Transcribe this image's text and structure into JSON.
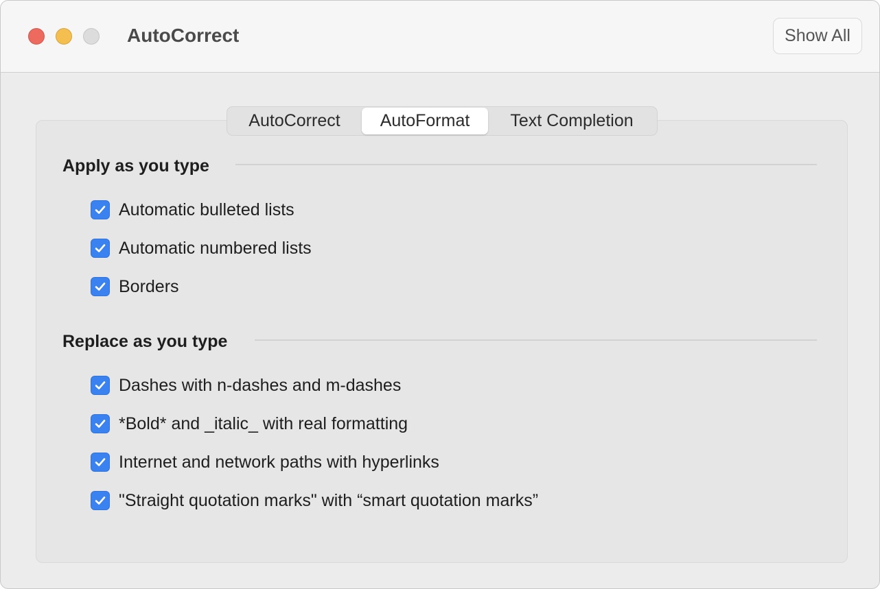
{
  "window": {
    "title": "AutoCorrect",
    "show_all_label": "Show All"
  },
  "tabs": [
    {
      "label": "AutoCorrect",
      "selected": false
    },
    {
      "label": "AutoFormat",
      "selected": true
    },
    {
      "label": "Text Completion",
      "selected": false
    }
  ],
  "sections": {
    "apply": {
      "title": "Apply as you type",
      "options": [
        {
          "label": "Automatic bulleted lists",
          "checked": true
        },
        {
          "label": "Automatic numbered lists",
          "checked": true
        },
        {
          "label": "Borders",
          "checked": true
        }
      ]
    },
    "replace": {
      "title": "Replace as you type",
      "options": [
        {
          "label": "Dashes with n-dashes and m-dashes",
          "checked": true
        },
        {
          "label": "*Bold* and _italic_ with real formatting",
          "checked": true
        },
        {
          "label": "Internet and network paths with hyperlinks",
          "checked": true
        },
        {
          "label": "\"Straight quotation marks\" with “smart quotation marks”",
          "checked": true
        }
      ]
    }
  },
  "colors": {
    "checkbox_accent": "#3b82f1",
    "close_button": "#ed6a5e",
    "minimize_button": "#f5bf4f",
    "zoom_button_inactive": "#dcdcdc"
  },
  "icons": {
    "checkmark": "checkmark-icon"
  }
}
